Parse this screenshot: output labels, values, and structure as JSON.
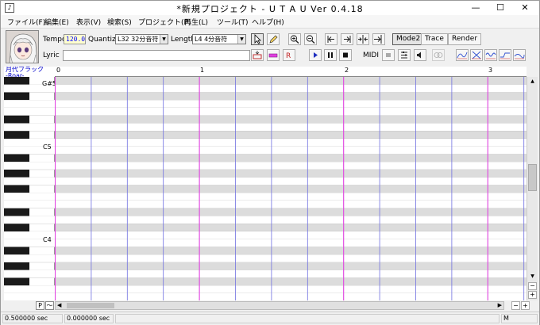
{
  "window": {
    "title": "*新規プロジェクト - U T A U  Ver 0.4.18",
    "app_icon": "♪",
    "minimize": "—",
    "maximize": "☐",
    "close": "✕"
  },
  "menu": [
    "ファイル(F)",
    "編集(E)",
    "表示(V)",
    "検索(S)",
    "プロジェクト(P)",
    "再生(L)",
    "ツール(T)",
    "ヘルプ(H)"
  ],
  "toolbar": {
    "tempo_label": "Tempo",
    "tempo_value": "120.0",
    "quantize_label": "Quantize",
    "quantize_value": "L32 32分音符",
    "length_label": "Length",
    "length_value": "L4  4分音符",
    "lyric_label": "Lyric",
    "lyric_value": "",
    "mode2": "Mode2",
    "trace": "Trace",
    "render": "Render",
    "midi": "MIDI"
  },
  "piano_roll": {
    "singer_line1": "月代ブラック",
    "singer_line2": "-Roar-",
    "measures": [
      "0",
      "1",
      "2",
      "3"
    ],
    "key_labels": [
      "G#5",
      "C5",
      "C4"
    ],
    "line_color": "#7070e0",
    "measure_line_color": "#e040e0"
  },
  "bottom": {
    "p_button": "P",
    "curve_button": "〜"
  },
  "status": {
    "time1": "0.500000 sec",
    "time2": "0.000000 sec",
    "mode": "M"
  }
}
